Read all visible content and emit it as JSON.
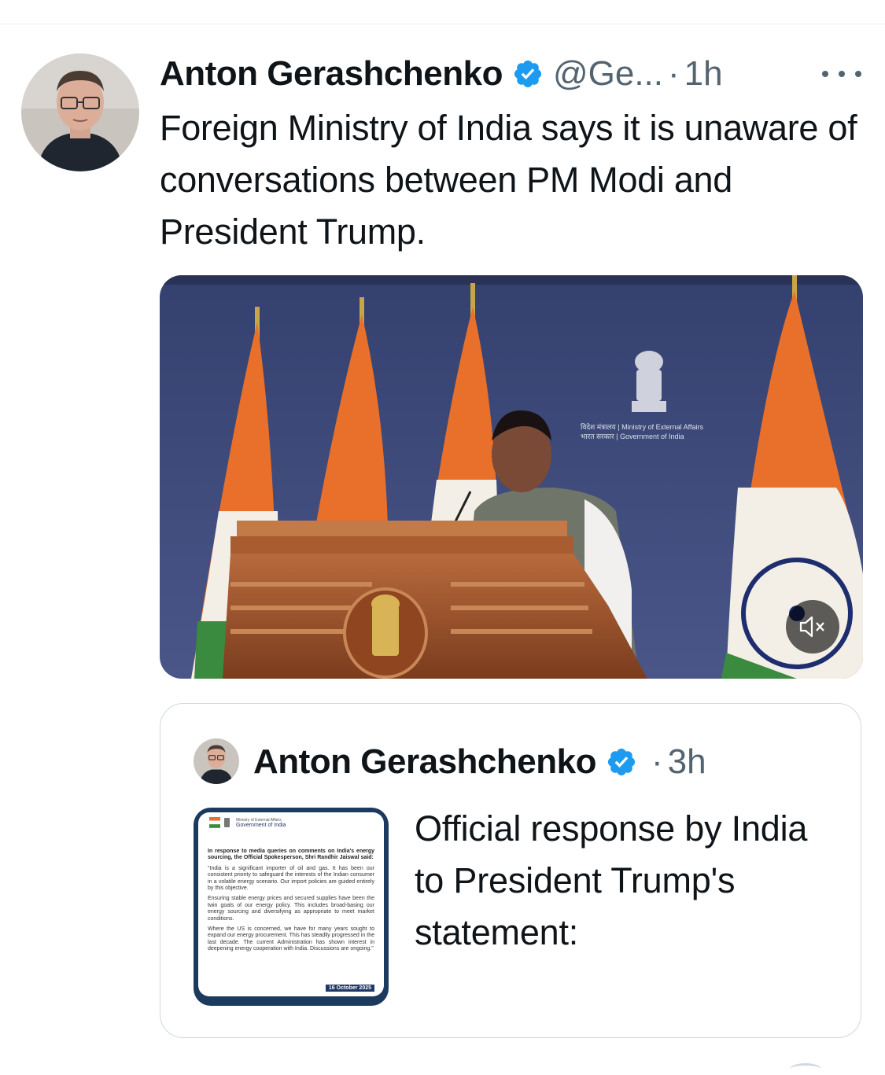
{
  "tweet": {
    "author_name": "Anton Gerashchenko",
    "handle": "@Ge...",
    "separator": "·",
    "time": "1h",
    "text": "Foreign Ministry of India says it is unaware of conversations between PM Modi and President Trump.",
    "media": {
      "kind": "video",
      "seal_caption_1": "विदेश मंत्रालय | Ministry of External Affairs",
      "seal_caption_2": "भारत सरकार | Government of India"
    }
  },
  "quoted_tweet": {
    "author_name": "Anton Gerashchenko",
    "separator": "·",
    "time": "3h",
    "text": "Official response by India to President Trump's statement:",
    "image_doc": {
      "org_line_1": "Ministry of External Affairs",
      "org_line_2": "Government of India",
      "lead": "In response to media queries on comments on India's energy sourcing, the Official Spokesperson, Shri Randhir Jaiswal said:",
      "para_1": "\"India is a significant importer of oil and gas. It has been our consistent priority to safeguard the interests of the Indian consumer in a volatile energy scenario. Our import policies are guided entirely by this objective.",
      "para_2": "Ensuring stable energy prices and secured supplies have been the twin goals of our energy policy. This includes broad-basing our energy sourcing and diversifying as appropriate to meet market conditions.",
      "para_3": "Where the US is concerned, we have for many years sought to expand our energy procurement. This has steadily progressed in the last decade. The current Administration has shown interest in deepening energy cooperation with India. Discussions are ongoing.\"",
      "date": "16 October 2025"
    }
  },
  "colors": {
    "verified_badge": "#1d9bf0",
    "secondary_text": "#536471",
    "border": "#cfd9de",
    "backdrop_blue": "#3d4a7a",
    "saffron": "#e8702a",
    "green": "#3a8a3f"
  }
}
